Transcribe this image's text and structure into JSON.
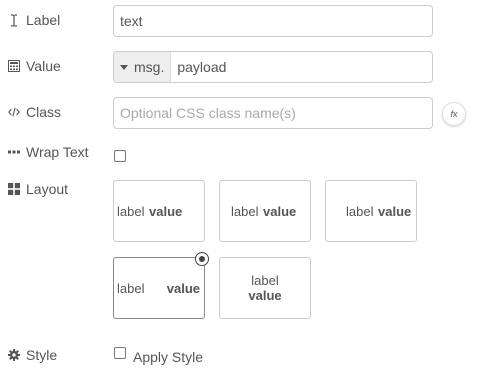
{
  "rows": {
    "label": {
      "title": "Label",
      "icon": "text-cursor-icon",
      "value": "text"
    },
    "value": {
      "title": "Value",
      "icon": "calculator-icon",
      "type_label": "msg.",
      "value": "payload"
    },
    "class": {
      "title": "Class",
      "icon": "code-icon",
      "placeholder": "Optional CSS class name(s)",
      "fx_label": "fx"
    },
    "wrap": {
      "title": "Wrap Text",
      "icon": "ellipsis-icon",
      "checked": false
    },
    "layout": {
      "title": "Layout",
      "icon": "grid-icon",
      "options": [
        {
          "label": "label",
          "value": "value",
          "selected": false
        },
        {
          "label": "label",
          "value": "value",
          "selected": false
        },
        {
          "label": "label",
          "value": "value",
          "selected": false
        },
        {
          "label": "label",
          "value": "value",
          "selected": true
        },
        {
          "label": "label",
          "value": "value",
          "selected": false
        }
      ]
    },
    "style": {
      "title": "Style",
      "icon": "gear-icon",
      "checkbox_label": "Apply Style",
      "checked": false
    }
  }
}
